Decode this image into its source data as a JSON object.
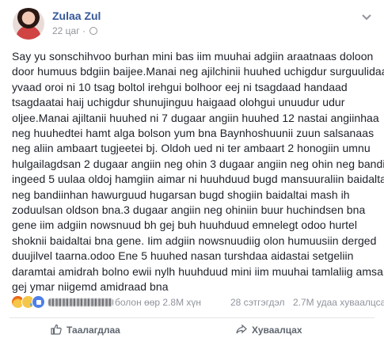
{
  "post": {
    "author": "Zulaa Zul",
    "time": "22 цаг",
    "text": "Say yu sonschihvoo burhan mini bas iim muuhai adgiin araatnaas doloon\ndoor humuus bdgiin baijee.Manai neg ajilchinii huuhed uchigdur surguulidaa\nyvaad oroi ni 10 tsag boltol irehgui bolhoor eej ni tsagdaad handaad\ntsagdaatai haij uchigdur shunujinguu haigaad olohgui unuudur udur\noljee.Manai ajiltanii huuhed ni 7 dugaar angiin huuhed 12 nastai angiinhaa\nneg huuhedtei hamt alga bolson yum bna Baynhoshuunii zuun salsanaas\nneg aliin ambaart tugjeetei bj. Oldoh ued ni ter ambaart 2 honogiin umnu\nhulgailagdsan 2 dugaar angiin neg ohin 3 dugaar angiin neg ohin neg bandi\ningeed 5 uulaa oldoj hamgiin aimar ni huuhduud bugd mansuuraliin baidalta\nneg bandiinhan hawurguud hugarsan bugd shogiin baidaltai mash ih\nzoduulsan oldson bna.3 dugaar angiin neg ohiniin buur huchindsen bna\ngene iim adgiin nowsnuud bh gej buh huuhduud emnelegt odoo hurtel\nshoknii baidaltai bna gene. Iim adgiin nowsnuudiig olon humuusiin derged\nduujilvel taarna.odoo Ene 5 huuhed nasan turshdaa aidastai setgeliin\ndaramtai amidrah bolno ewii nylh huuhduud mini iim muuhai tamlaliig amsah\ngej ymar niigemd amidraad bna"
  },
  "reactions": {
    "icons": [
      "angry-icon",
      "sad-icon",
      "like-icon"
    ],
    "summary": "болон өөр 2.8M хүн"
  },
  "stats": {
    "comments": "28 сэтгэгдэл",
    "shares": "2.7M удаа хуваалцсан"
  },
  "actions": {
    "like_label": "Таалагдлаа",
    "share_label": "Хуваалцах"
  },
  "colors": {
    "author": "#365899",
    "meta": "#90949c",
    "text": "#1d2129",
    "action": "#606770"
  }
}
